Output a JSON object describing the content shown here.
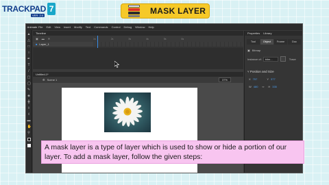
{
  "logo": {
    "text": "TRACKPAD",
    "version": "7",
    "tag": "VER. 2.0"
  },
  "banner": {
    "title": "MASK LAYER"
  },
  "app": {
    "name": "Animate",
    "menu": [
      "File",
      "Edit",
      "View",
      "Insert",
      "Modify",
      "Text",
      "Commands",
      "Control",
      "Debug",
      "Window",
      "Help"
    ],
    "timeline": {
      "tab": "Timeline",
      "layer_name": "Layer_1",
      "ruler": [
        "1s",
        "2s",
        "3s",
        "4s",
        "5s",
        "6s",
        "7s",
        "8s"
      ]
    },
    "document": {
      "tab": "Untitled-1*",
      "scene": "Scene 1",
      "zoom": "37%"
    },
    "properties": {
      "tabs": [
        "Properties",
        "Library"
      ],
      "subtabs": [
        "Tool",
        "Object",
        "Frame",
        "Doc"
      ],
      "active_subtab": "Object",
      "type_label": "Bitmap",
      "instance_label": "Instance of:",
      "instance_value": "bitm...",
      "swap_label": "Trace",
      "section_title": "Position and Size",
      "x_label": "X",
      "x_value": "757",
      "y_label": "Y",
      "y_value": "377",
      "w_label": "W",
      "w_value": "480",
      "h_label": "H",
      "h_value": "335"
    }
  },
  "caption": {
    "text": "A mask layer is a type of layer which is used to show or hide a portion of our layer. To add a mask layer, follow the given steps:"
  }
}
